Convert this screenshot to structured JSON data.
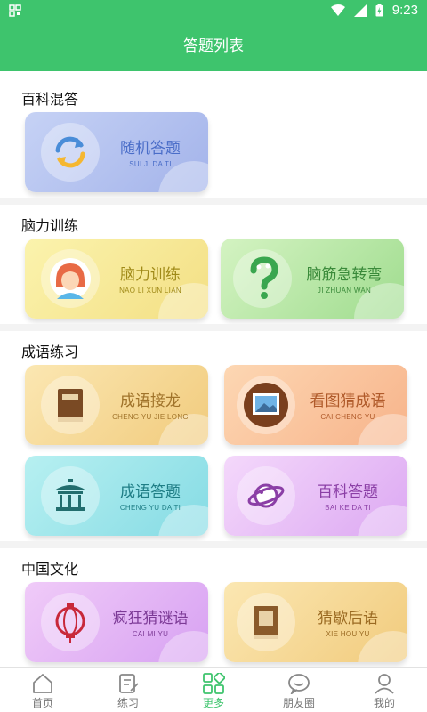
{
  "status": {
    "time": "9:23"
  },
  "header": {
    "title": "答题列表"
  },
  "sections": [
    {
      "title": "百科混答"
    },
    {
      "title": "脑力训练"
    },
    {
      "title": "成语练习"
    },
    {
      "title": "中国文化"
    }
  ],
  "cards": {
    "random": {
      "title": "随机答题",
      "sub": "SUI JI DA TI"
    },
    "brain": {
      "title": "脑力训练",
      "sub": "NAO LI XUN LIAN"
    },
    "twister": {
      "title": "脑筋急转弯",
      "sub": "JI ZHUAN WAN"
    },
    "chain": {
      "title": "成语接龙",
      "sub": "CHENG YU JIE LONG"
    },
    "picture": {
      "title": "看图猜成语",
      "sub": "CAI CHENG YU"
    },
    "idiomqa": {
      "title": "成语答题",
      "sub": "CHENG YU DA TI"
    },
    "baike": {
      "title": "百科答题",
      "sub": "BAI KE DA TI"
    },
    "riddle": {
      "title": "疯狂猜谜语",
      "sub": "CAI MI YU"
    },
    "xiehou": {
      "title": "猜歇后语",
      "sub": "XIE HOU YU"
    }
  },
  "tabs": [
    {
      "label": "首页",
      "icon": "home-icon"
    },
    {
      "label": "练习",
      "icon": "practice-icon"
    },
    {
      "label": "更多",
      "icon": "more-icon",
      "active": true
    },
    {
      "label": "朋友圈",
      "icon": "chat-icon"
    },
    {
      "label": "我的",
      "icon": "profile-icon"
    }
  ],
  "colors": {
    "brand": "#3ec46d"
  }
}
